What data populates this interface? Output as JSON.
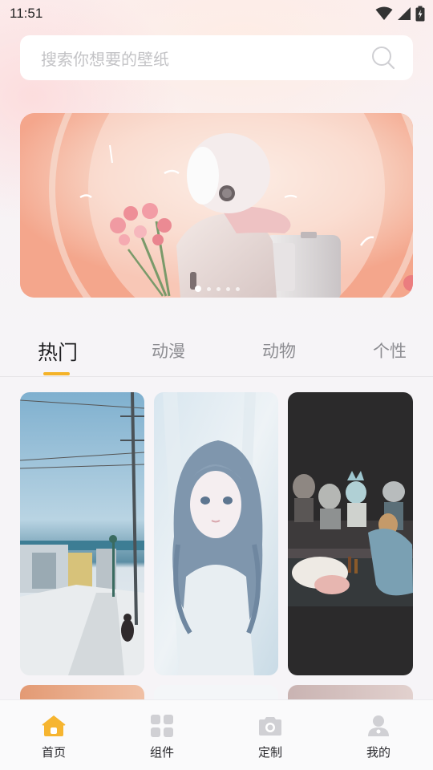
{
  "status_bar": {
    "time": "11:51"
  },
  "search": {
    "placeholder": "搜索你想要的壁纸"
  },
  "banner": {
    "dot_count": 5,
    "active_dot": 0
  },
  "tabs": [
    {
      "label": "热门",
      "active": true
    },
    {
      "label": "动漫",
      "active": false
    },
    {
      "label": "动物",
      "active": false
    },
    {
      "label": "个性",
      "active": false
    }
  ],
  "colors": {
    "accent": "#f4b228",
    "nav_icon_inactive": "#d0d0d4"
  },
  "bottom_nav": [
    {
      "label": "首页",
      "icon": "home-icon",
      "active": true
    },
    {
      "label": "组件",
      "icon": "widgets-grid-icon",
      "active": false
    },
    {
      "label": "定制",
      "icon": "camera-icon",
      "active": false
    },
    {
      "label": "我的",
      "icon": "profile-icon",
      "active": false
    }
  ]
}
